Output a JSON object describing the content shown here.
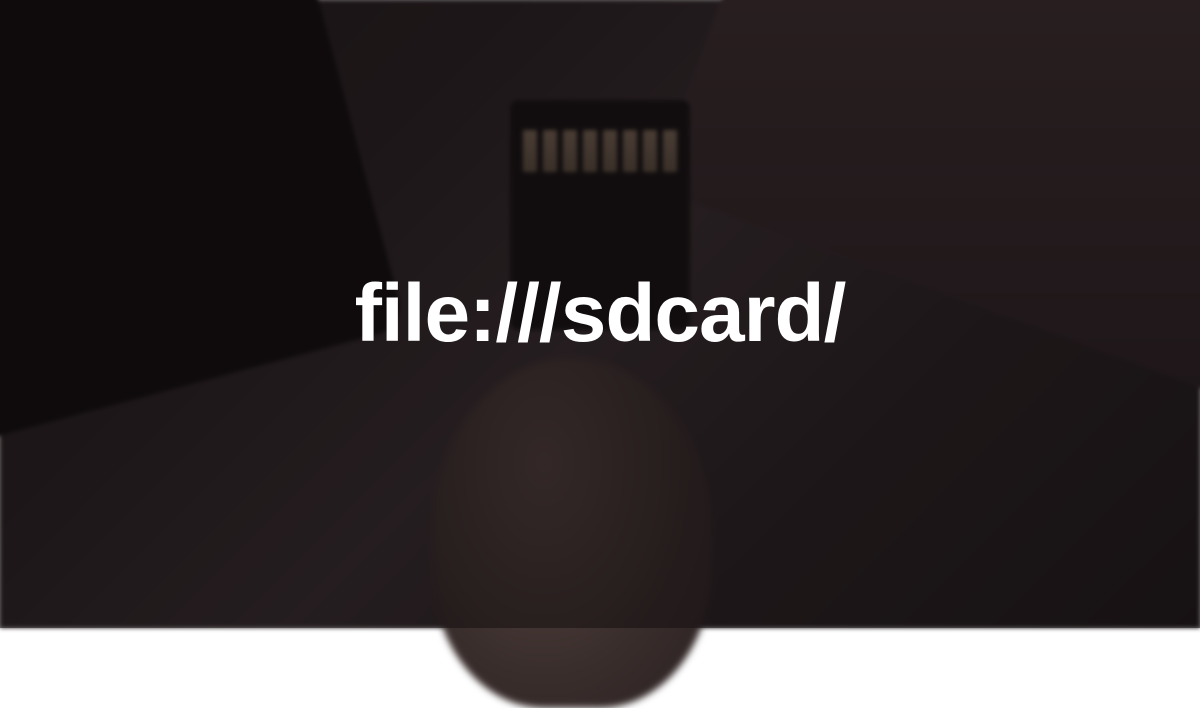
{
  "title": "file:///sdcard/"
}
